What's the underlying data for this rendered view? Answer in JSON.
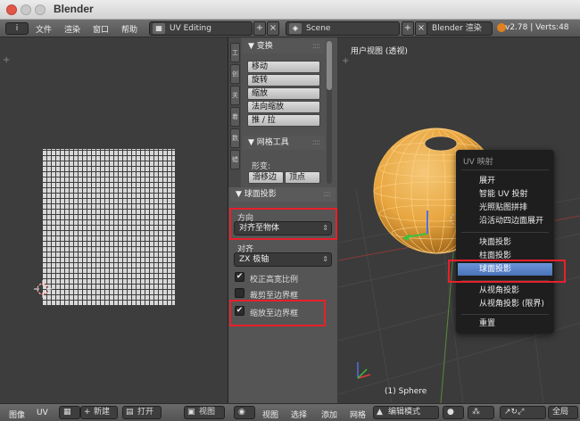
{
  "window": {
    "app_title": "Blender"
  },
  "info_header": {
    "info_icon": "i",
    "menus": [
      "文件",
      "渲染",
      "窗口",
      "帮助"
    ],
    "layout_value": "UV Editing",
    "scene_value": "Scene",
    "render_engine": "Blender 渲染",
    "version_text": "v2.78 | Verts:48"
  },
  "tool_shelf": {
    "tabs": [
      "工",
      "创",
      "关",
      "着",
      "数",
      "蜡"
    ],
    "transform_header": "▼ 变换",
    "transform_buttons": [
      "移动",
      "旋转",
      "缩放",
      "法向缩放",
      "推 / 拉"
    ],
    "mesh_tools_header": "▼ 网格工具",
    "deform_label": "形变:",
    "deform_buttons": [
      "滑移边",
      "顶点"
    ]
  },
  "operator_panel": {
    "header": "▼ 球面投影",
    "direction_label": "方向",
    "direction_value": "对齐至物体",
    "align_label": "对齐",
    "align_value": "ZX 极轴",
    "checkboxes": [
      {
        "label": "校正高宽比例",
        "checked": true
      },
      {
        "label": "裁剪至边界框",
        "checked": false
      },
      {
        "label": "缩放至边界框",
        "checked": true
      }
    ]
  },
  "viewport": {
    "view_label": "用户视图 (透视)",
    "object_label": "(1) Sphere"
  },
  "uv_menu": {
    "title": "UV 映射",
    "items": [
      "展开",
      "智能 UV 投射",
      "光照贴图拼排",
      "沿活动四边面展开",
      "块面投影",
      "柱面投影",
      "球面投影",
      "从视角投影",
      "从视角投影 (限界)",
      "重置"
    ],
    "highlighted": "球面投影"
  },
  "bottom_bar": {
    "uv_left": [
      "图像",
      "UV"
    ],
    "new_label": "新建",
    "open_label": "打开",
    "view_label": "视图",
    "vp_items": [
      "视图",
      "选择",
      "添加",
      "网格"
    ],
    "mode": "编辑模式",
    "global": "全局"
  },
  "colors": {
    "sphere": "#e8a640",
    "highlight": "#5a85cc",
    "annotation": "#e8202a"
  }
}
